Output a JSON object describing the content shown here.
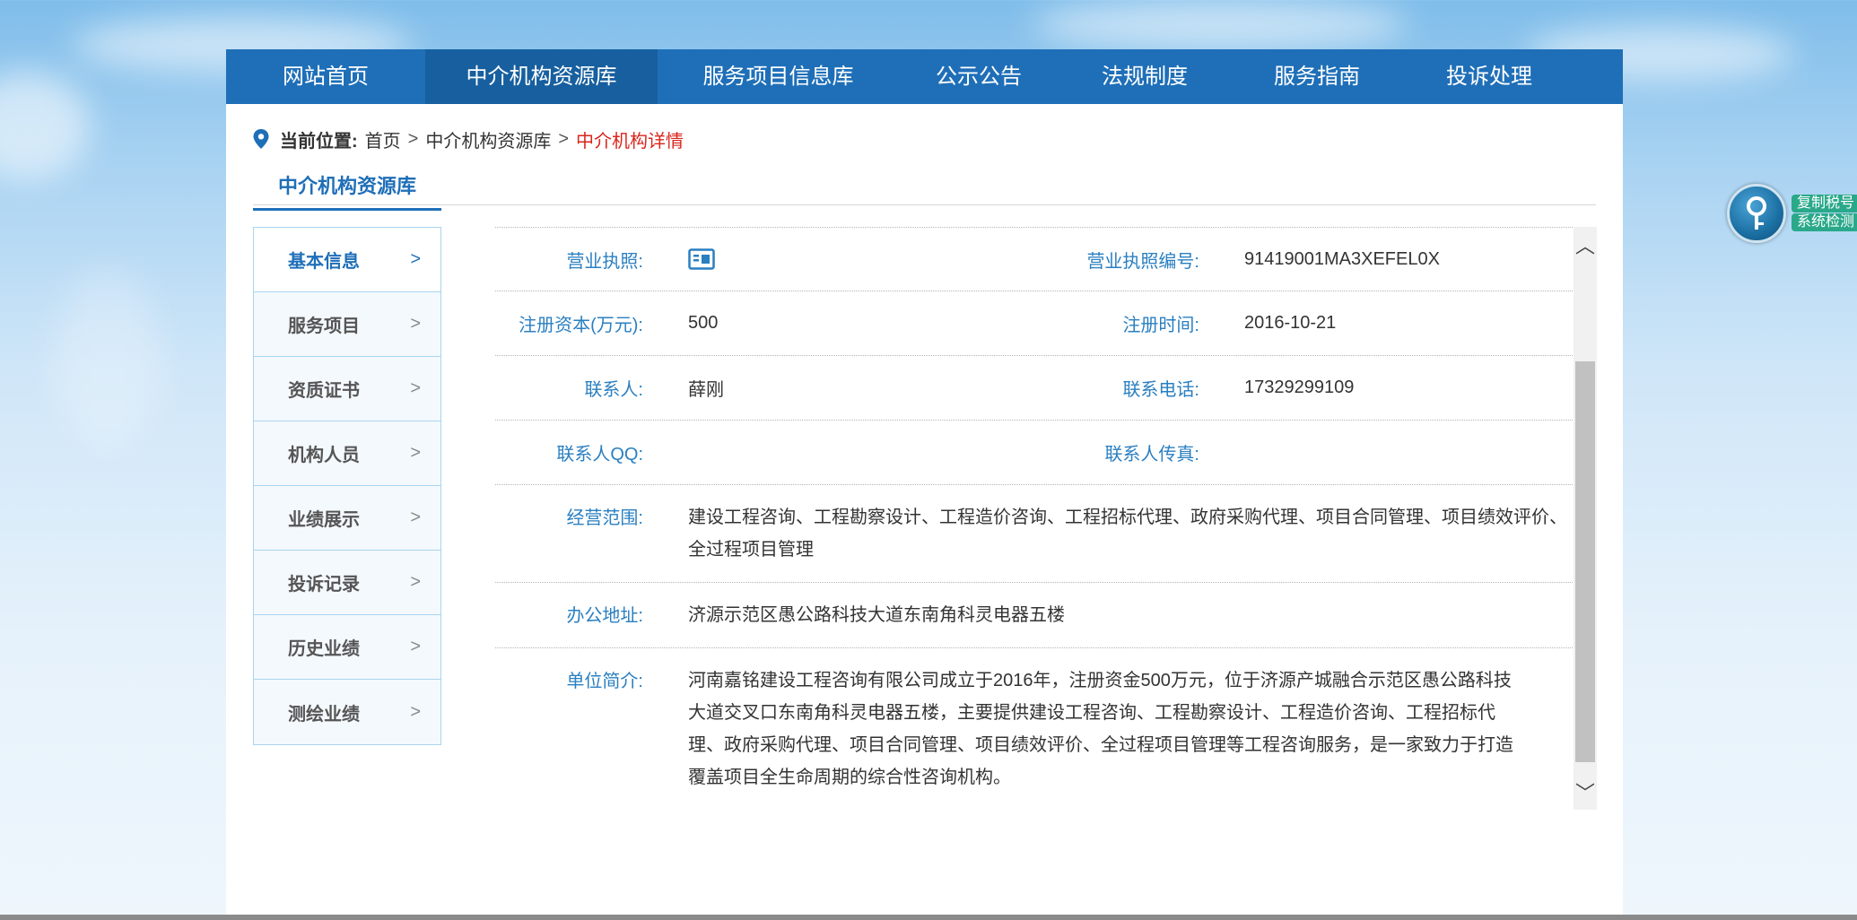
{
  "nav": {
    "items": [
      {
        "label": "网站首页"
      },
      {
        "label": "中介机构资源库"
      },
      {
        "label": "服务项目信息库"
      },
      {
        "label": "公示公告"
      },
      {
        "label": "法规制度"
      },
      {
        "label": "服务指南"
      },
      {
        "label": "投诉处理"
      }
    ],
    "active_index": 1
  },
  "breadcrumb": {
    "label": "当前位置:",
    "items": [
      "首页",
      "中介机构资源库"
    ],
    "separator": ">",
    "current": "中介机构详情"
  },
  "section": {
    "title": "中介机构资源库"
  },
  "sidebar": {
    "items": [
      {
        "label": "基本信息"
      },
      {
        "label": "服务项目"
      },
      {
        "label": "资质证书"
      },
      {
        "label": "机构人员"
      },
      {
        "label": "业绩展示"
      },
      {
        "label": "投诉记录"
      },
      {
        "label": "历史业绩"
      },
      {
        "label": "测绘业绩"
      }
    ],
    "active_index": 0
  },
  "details": {
    "license_label": "营业执照:",
    "license_no_label": "营业执照编号:",
    "license_no": "91419001MA3XEFEL0X",
    "capital_label": "注册资本(万元):",
    "capital": "500",
    "reg_time_label": "注册时间:",
    "reg_time": "2016-10-21",
    "contact_label": "联系人:",
    "contact": "薛刚",
    "phone_label": "联系电话:",
    "phone": "17329299109",
    "qq_label": "联系人QQ:",
    "qq": "",
    "fax_label": "联系人传真:",
    "fax": "",
    "scope_label": "经营范围:",
    "scope": "建设工程咨询、工程勘察设计、工程造价咨询、工程招标代理、政府采购代理、项目合同管理、项目绩效评价、全过程项目管理",
    "address_label": "办公地址:",
    "address": "济源示范区愚公路科技大道东南角科灵电器五楼",
    "intro_label": "单位简介:",
    "intro": "河南嘉铭建设工程咨询有限公司成立于2016年，注册资金500万元，位于济源产城融合示范区愚公路科技大道交叉口东南角科灵电器五楼，主要提供建设工程咨询、工程勘察设计、工程造价咨询、工程招标代理、政府采购代理、项目合同管理、项目绩效评价、全过程项目管理等工程咨询服务，是一家致力于打造覆盖项目全生命周期的综合性咨询机构。"
  },
  "scrollbar": {
    "up": "︿",
    "down": "﹀"
  },
  "key_widget": {
    "line1": "复制税号",
    "line2": "系统检测"
  },
  "colors": {
    "nav_bg": "#1f6fb8",
    "nav_active": "#175f9f",
    "label_blue": "#2a7fc1",
    "breadcrumb_current": "#d9261c"
  }
}
